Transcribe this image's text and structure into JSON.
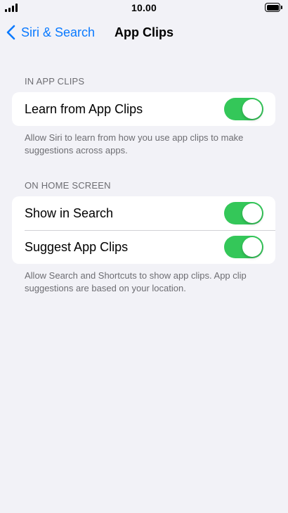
{
  "status_bar": {
    "time": "10.00",
    "signal_icon": "cellular-signal-icon",
    "battery_icon": "battery-full-icon"
  },
  "nav": {
    "back_label": "Siri & Search",
    "back_icon": "chevron-left-icon",
    "title": "App Clips"
  },
  "sections": [
    {
      "header": "IN APP CLIPS",
      "rows": [
        {
          "label": "Learn from App Clips",
          "toggle_on": true
        }
      ],
      "footer": "Allow Siri to learn from how you use app clips to make suggestions across apps."
    },
    {
      "header": "ON HOME SCREEN",
      "rows": [
        {
          "label": "Show in Search",
          "toggle_on": true
        },
        {
          "label": "Suggest App Clips",
          "toggle_on": true
        }
      ],
      "footer": "Allow Search and Shortcuts to show app clips. App clip suggestions are based on your location."
    }
  ],
  "colors": {
    "accent": "#0a7aff",
    "toggle_on": "#34c759",
    "background": "#f2f2f7",
    "secondary_text": "#6d6d72"
  }
}
